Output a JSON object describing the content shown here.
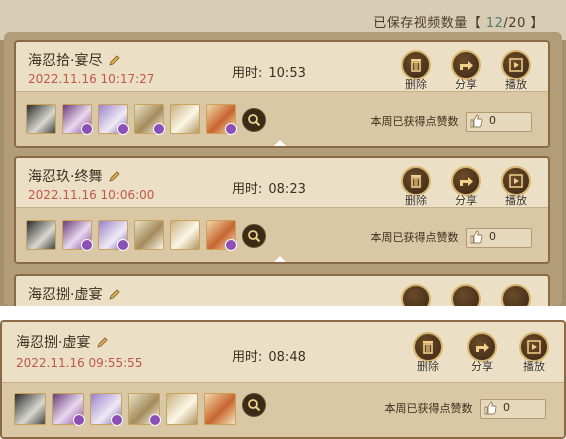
{
  "header": {
    "save_label": "已保存视频数量",
    "bracket_open": "【",
    "count_current": "12",
    "count_sep": "/",
    "count_total": "20",
    "bracket_close": "】"
  },
  "common": {
    "duration_label": "用时:",
    "delete_label": "删除",
    "share_label": "分享",
    "play_label": "播放",
    "likes_label": "本周已获得点赞数"
  },
  "videos": [
    {
      "title": "海忍拾·宴尽",
      "date": "2022.11.16 10:17:27",
      "duration": "10:53",
      "likes": "0"
    },
    {
      "title": "海忍玖·终舞",
      "date": "2022.11.16 10:06:00",
      "duration": "08:23",
      "likes": "0"
    },
    {
      "title": "海忍捌·虚宴",
      "date": "2022.11.16 09:55:55",
      "duration": "08:48",
      "likes": "0"
    }
  ],
  "icons": {
    "edit": "pencil-icon",
    "delete": "trash-icon",
    "share": "share-icon",
    "play": "play-icon",
    "search": "search-icon",
    "like": "thumbs-up-icon",
    "expand": "expand-arrow-icon"
  },
  "colors": {
    "date": "#c0574a",
    "count": "#4f7a6e",
    "card_bg": "#ebdfc6",
    "frame": "#8a6a44"
  }
}
